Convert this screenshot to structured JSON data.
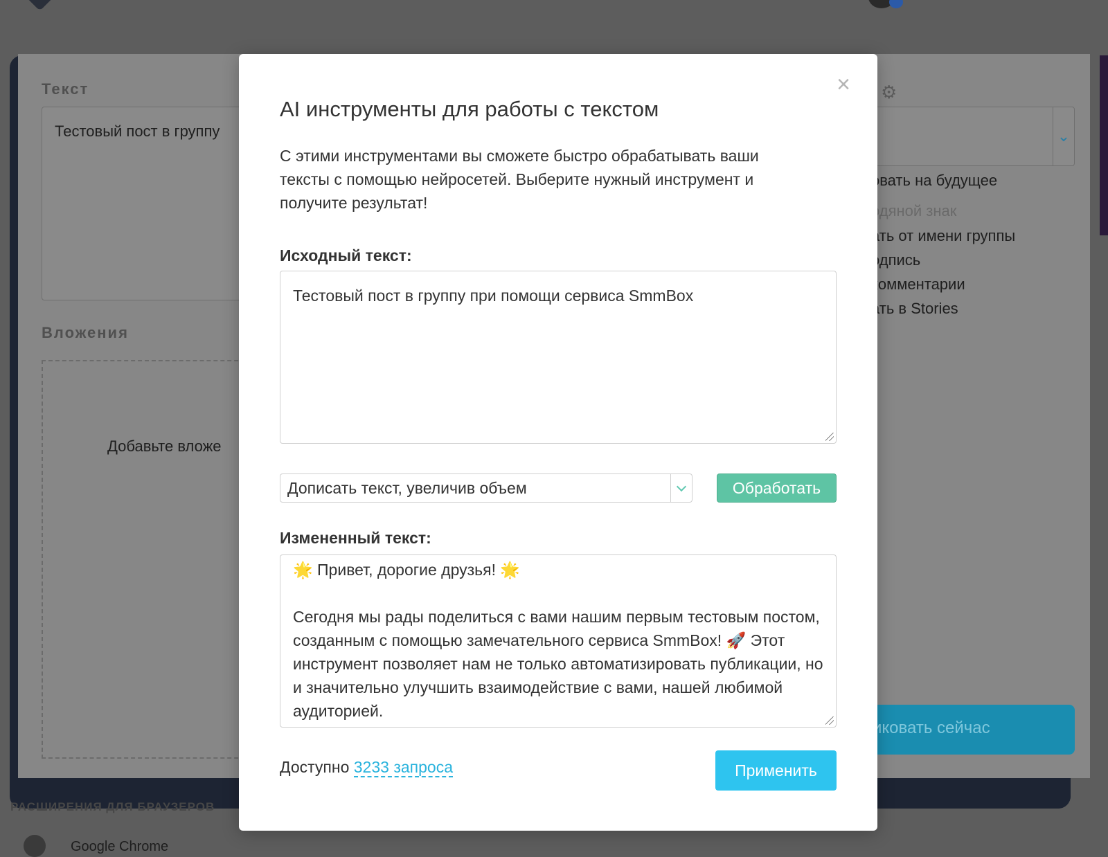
{
  "background": {
    "text_label": "Текст",
    "text_value": "Тестовый пост в группу",
    "attachments_label": "Вложения",
    "add_attachment": "Добавьте вложе",
    "options": [
      {
        "label": "овать на будущее",
        "muted": false
      },
      {
        "label": "одяной знак",
        "muted": true
      },
      {
        "label": "ать от имени группы",
        "muted": false
      },
      {
        "label": "одпись",
        "muted": false
      },
      {
        "label": " комментарии",
        "muted": false
      },
      {
        "label": "ать в Stories",
        "muted": false
      }
    ],
    "publish_now": "иковать сейчас",
    "extensions_title": "РАСШИРЕНИЯ ДЛЯ БРАУЗЕРОВ",
    "chrome_label": "Google Chrome"
  },
  "modal": {
    "close_symbol": "×",
    "title": "AI инструменты для работы с текстом",
    "description": "С этими инструментами вы сможете быстро обрабатывать ваши тексты с помощью нейросетей. Выберите нужный инструмент и получите результат!",
    "source_label": "Исходный текст:",
    "source_text": "Тестовый пост в группу при помощи сервиса SmmBox",
    "tool_selected": "Дописать текст, увеличив объем",
    "process_button": "Обработать",
    "result_label": "Измененный текст:",
    "result_text": "🌟 Привет, дорогие друзья! 🌟\n\nСегодня мы рады поделиться с вами нашим первым тестовым постом, созданным с помощью замечательного сервиса SmmBox! 🚀 Этот инструмент позволяет нам не только автоматизировать публикации, но и значительно улучшить взаимодействие с вами, нашей любимой аудиторией.",
    "available_prefix": "Доступно ",
    "available_link": "3233 запроса",
    "apply_button": "Применить"
  }
}
